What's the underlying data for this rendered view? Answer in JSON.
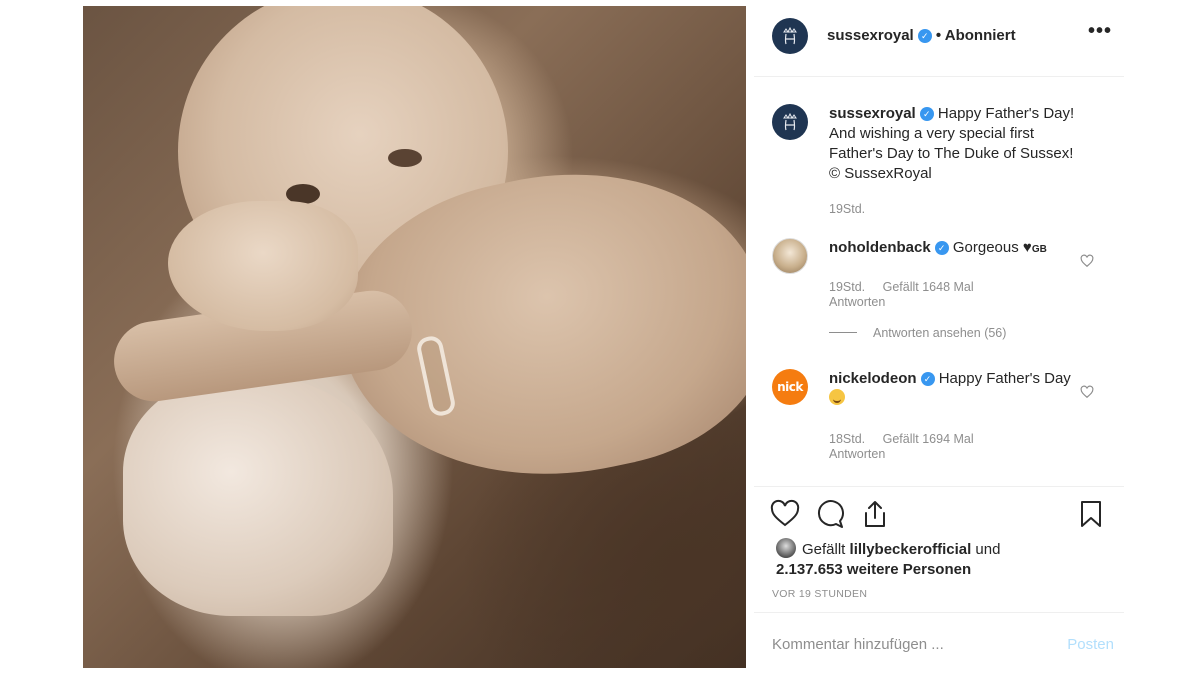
{
  "post": {
    "username": "sussexroyal",
    "follow_status": "• Abonniert",
    "more_label": "•••",
    "caption": "Happy Father's Day! And wishing a very special first Father's Day to The Duke of Sussex! © SussexRoyal",
    "caption_time": "19Std."
  },
  "comments": [
    {
      "username": "noholdenback",
      "text": "Gorgeous",
      "badge": "GB",
      "time": "19Std.",
      "likes": "Gefällt 1648 Mal",
      "reply": "Antworten",
      "view_replies": "Antworten ansehen (56)"
    },
    {
      "username": "nickelodeon",
      "text": "Happy Father's Day",
      "time": "18Std.",
      "likes": "Gefällt 1694 Mal",
      "reply": "Antworten"
    }
  ],
  "nick_logo_text": "nick",
  "likes_summary": {
    "prefix": "Gefällt ",
    "user": "lillybeckerofficial",
    "middle": " und",
    "count_line": "2.137.653 weitere Personen"
  },
  "post_time": "VOR 19 STUNDEN",
  "comment_input": {
    "placeholder": "Kommentar hinzufügen ...",
    "post_label": "Posten"
  },
  "colors": {
    "verified": "#3897f0",
    "post_button": "#b2dffc",
    "nickelodeon_orange": "#f57c10",
    "royal_navy": "#1f3552"
  }
}
